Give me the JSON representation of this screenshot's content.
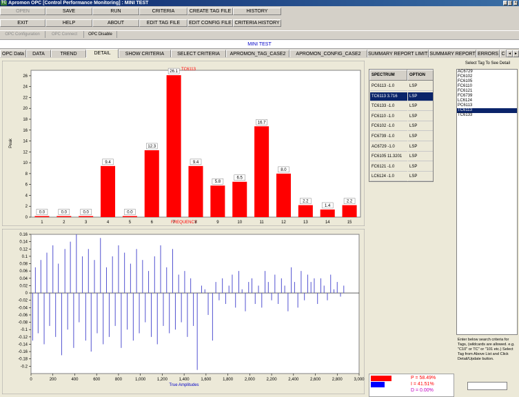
{
  "window": {
    "title": "Apromon OPC [Control Performance Monitoring] : MINI TEST",
    "app_icon_text": "TC",
    "minimize": "_",
    "maximize": "□",
    "close": "×"
  },
  "toolbar_row1": [
    "OPEN",
    "SAVE",
    "RUN",
    "CRITERIA",
    "CREATE TAG FILE",
    "HISTORY"
  ],
  "toolbar_row2": [
    "EXIT",
    "HELP",
    "ABOUT",
    "EDIT TAG FILE",
    "EDIT CONFIG FILE",
    "CRITERIA HISTORY"
  ],
  "opc_bar": [
    "OPC Configuration",
    "OPC Connect",
    "OPC Disable"
  ],
  "banner": "MINI TEST",
  "tabs": [
    "OPC Data",
    "DATA",
    "TREND",
    "DETAIL",
    "SHOW CRITERIA",
    "SELECT CRITERIA",
    "APROMON_TAG_CASE2",
    "APROMON_CONFIG_CASE2",
    "SUMMARY REPORT LIMITS",
    "SUMMARY REPORT",
    "ERRORS",
    "C"
  ],
  "active_tab": "DETAIL",
  "tab_scroll": {
    "left": "◄",
    "right": "►"
  },
  "spectrum_table": {
    "headers": [
      "SPECTRUM",
      "OPTION"
    ],
    "rows": [
      {
        "spectrum": "PC6113 -1.0",
        "option": "LSP"
      },
      {
        "spectrum": "TC6113 3.716",
        "option": "LSP"
      },
      {
        "spectrum": "TC6133 -1.0",
        "option": "LSP"
      },
      {
        "spectrum": "FC6110 -1.0",
        "option": "LSP"
      },
      {
        "spectrum": "FC6102 -1.0",
        "option": "LSP"
      },
      {
        "spectrum": "FC6739 -1.0",
        "option": "LSP"
      },
      {
        "spectrum": "AC6729 -1.0",
        "option": "LSP"
      },
      {
        "spectrum": "FC6105 11.3201",
        "option": "LSP"
      },
      {
        "spectrum": "FC6121 -1.0",
        "option": "LSP"
      },
      {
        "spectrum": "LC6124 -1.0",
        "option": "LSP"
      }
    ]
  },
  "tag_panel": {
    "header": "Select Tag To See Detail",
    "tags": [
      "AC6729",
      "FC6102",
      "FC6105",
      "FC6110",
      "FC6121",
      "FC6739",
      "LC6124",
      "PC6113",
      "TC6113",
      "TC6133"
    ],
    "selected": "TC6113",
    "help_text": "Enter below search criteria for Tags, (wildcards are allowed. e.g. \"C10\" or TC\" or \"101 etc.) Select Tag from Above List and Click Detail/Update button."
  },
  "legend": {
    "p": "P = 58.49%",
    "i": "I = 41.51%",
    "d": "D = 0.00%",
    "colors": {
      "p": "#ff0000",
      "i": "#0000ff"
    }
  },
  "chart_data": [
    {
      "type": "bar",
      "title": "TC6113",
      "xlabel": "FREQUENCY",
      "ylabel": "Peak",
      "categories": [
        "1",
        "2",
        "3",
        "4",
        "5",
        "6",
        "7",
        "8",
        "9",
        "10",
        "11",
        "12",
        "13",
        "14",
        "15"
      ],
      "values": [
        0.0,
        0.0,
        0.0,
        9.4,
        0.0,
        12.3,
        26.1,
        9.4,
        5.8,
        6.5,
        16.7,
        8.0,
        2.2,
        1.4,
        2.2
      ],
      "labels": [
        "0.0",
        "0.0",
        "0.0",
        "9.4",
        "0.0",
        "12.3",
        "26.1",
        "9.4",
        "5.8",
        "6.5",
        "16.7",
        "8.0",
        "2.2",
        "1.4",
        "2.2"
      ],
      "ylim": [
        0,
        27
      ],
      "yticks": [
        "0",
        "2",
        "4",
        "6",
        "8",
        "10",
        "12",
        "14",
        "16",
        "18",
        "20",
        "22",
        "24",
        "26"
      ],
      "color": "#ff0000",
      "grid": false
    },
    {
      "type": "bar",
      "xlabel": "True Amplitudes",
      "ylabel": "",
      "xlim": [
        0,
        3000
      ],
      "ylim": [
        -0.22,
        0.16
      ],
      "xticks": [
        "0",
        "200",
        "400",
        "600",
        "800",
        "1,000",
        "1,200",
        "1,400",
        "1,600",
        "1,800",
        "2,000",
        "2,200",
        "2,400",
        "2,600",
        "2,800",
        "3,000"
      ],
      "yticks": [
        "0.16",
        "0.14",
        "0.12",
        "0.1",
        "0.08",
        "0.06",
        "0.04",
        "0.02",
        "0",
        "-0.02",
        "-0.04",
        "-0.06",
        "-0.08",
        "-0.1",
        "-0.12",
        "-0.14",
        "-0.16",
        "-0.18",
        "-0.2"
      ],
      "color": "#5050d0",
      "grid": false,
      "x": [
        15,
        40,
        65,
        90,
        120,
        145,
        170,
        200,
        225,
        250,
        280,
        310,
        335,
        360,
        390,
        415,
        440,
        470,
        500,
        525,
        550,
        580,
        605,
        635,
        660,
        690,
        715,
        745,
        770,
        800,
        825,
        855,
        880,
        910,
        935,
        965,
        990,
        1020,
        1045,
        1075,
        1100,
        1130,
        1155,
        1185,
        1210,
        1240,
        1265,
        1295,
        1320,
        1350,
        1375,
        1405,
        1430,
        1460,
        1485,
        1520,
        1560,
        1590,
        1620,
        1660,
        1690,
        1720,
        1750,
        1780,
        1810,
        1840,
        1870,
        1900,
        1930,
        1960,
        1990,
        2020,
        2050,
        2080,
        2110,
        2140,
        2170,
        2200,
        2230,
        2260,
        2290,
        2320,
        2350,
        2380,
        2410,
        2440,
        2470,
        2500,
        2530,
        2560,
        2590,
        2620,
        2650,
        2680,
        2710,
        2740,
        2770,
        2800,
        2830,
        2860
      ],
      "y": [
        -0.13,
        0.07,
        -0.11,
        0.09,
        -0.14,
        0.11,
        -0.09,
        0.13,
        -0.12,
        0.08,
        -0.17,
        0.12,
        -0.1,
        0.14,
        -0.15,
        0.16,
        -0.08,
        0.1,
        -0.13,
        0.12,
        -0.16,
        0.09,
        -0.11,
        0.15,
        -0.14,
        0.07,
        -0.12,
        0.1,
        -0.09,
        0.13,
        -0.15,
        0.11,
        -0.1,
        0.08,
        -0.13,
        0.12,
        -0.11,
        0.09,
        -0.08,
        0.06,
        -0.12,
        0.1,
        -0.14,
        0.13,
        -0.09,
        0.07,
        -0.11,
        0.12,
        -0.1,
        0.05,
        -0.08,
        0.06,
        -0.12,
        0.04,
        -0.09,
        -0.21,
        0.02,
        0.01,
        -0.06,
        -0.13,
        0.03,
        -0.02,
        0.04,
        -0.03,
        0.02,
        0.05,
        -0.04,
        0.06,
        0.01,
        -0.05,
        0.03,
        0.04,
        -0.03,
        0.02,
        -0.04,
        0.06,
        0.03,
        -0.02,
        0.05,
        -0.03,
        0.04,
        0.02,
        -0.05,
        0.07,
        0.03,
        -0.04,
        0.06,
        -0.02,
        0.05,
        0.03,
        0.04,
        -0.03,
        0.04,
        0.02,
        -0.02,
        0.05,
        0.01,
        0.03,
        -0.01,
        0.02
      ]
    }
  ]
}
